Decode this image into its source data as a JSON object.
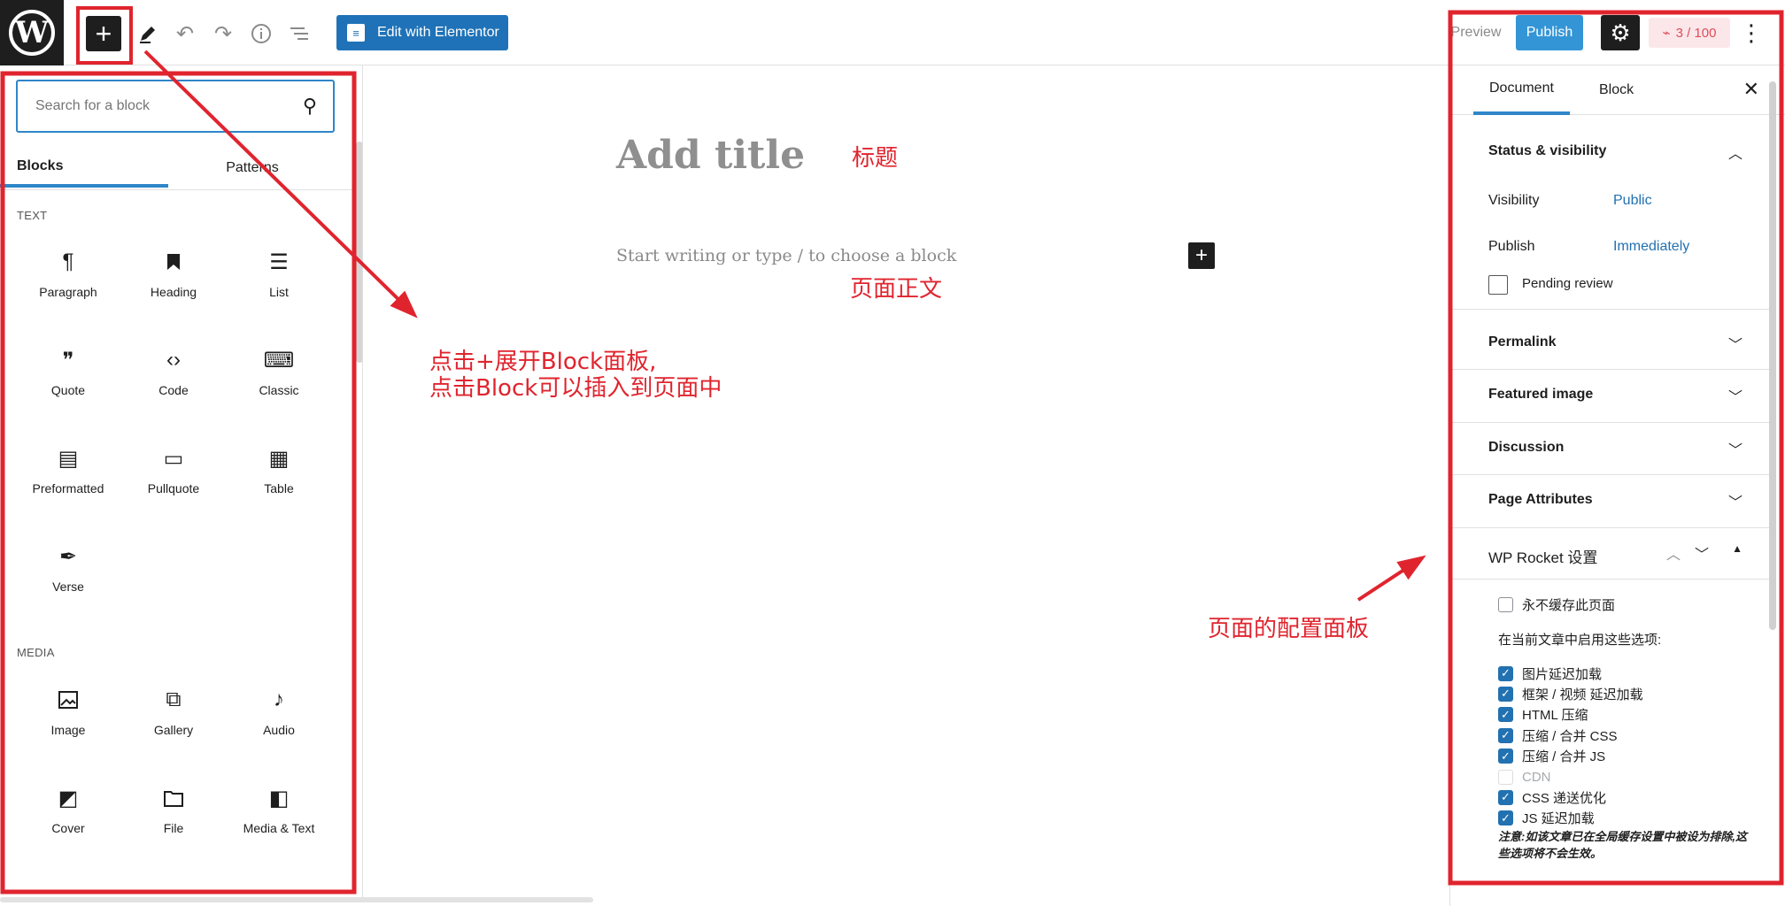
{
  "toolbar": {
    "logo_letter": "W",
    "inserter_glyph": "+",
    "elementor_label": "Edit with Elementor",
    "preview_label": "Preview",
    "publish_label": "Publish",
    "score_label": "3 / 100",
    "accent_color": "#1f72b7",
    "icons": [
      "wordpress-logo",
      "plus-icon",
      "pencil-icon",
      "undo-icon",
      "redo-icon",
      "info-icon",
      "list-view-icon",
      "elementor-icon",
      "gear-icon",
      "seo-score-icon",
      "more-vertical-icon"
    ]
  },
  "inserter": {
    "search_placeholder": "Search for a block",
    "tabs": [
      "Blocks",
      "Patterns"
    ],
    "categories": [
      {
        "label": "TEXT",
        "blocks": [
          {
            "label": "Paragraph",
            "icon": "¶"
          },
          {
            "label": "Heading",
            "icon": "🔖"
          },
          {
            "label": "List",
            "icon": "☰"
          },
          {
            "label": "Quote",
            "icon": "❞"
          },
          {
            "label": "Code",
            "icon": "‹›"
          },
          {
            "label": "Classic",
            "icon": "⌨"
          },
          {
            "label": "Preformatted",
            "icon": "▤"
          },
          {
            "label": "Pullquote",
            "icon": "▭"
          },
          {
            "label": "Table",
            "icon": "▦"
          },
          {
            "label": "Verse",
            "icon": "✒"
          }
        ]
      },
      {
        "label": "MEDIA",
        "blocks": [
          {
            "label": "Image",
            "icon": "🖼"
          },
          {
            "label": "Gallery",
            "icon": "⧉"
          },
          {
            "label": "Audio",
            "icon": "♪"
          },
          {
            "label": "Cover",
            "icon": "◩"
          },
          {
            "label": "File",
            "icon": "🗀"
          },
          {
            "label": "Media & Text",
            "icon": "◧"
          }
        ]
      }
    ]
  },
  "editor": {
    "title_placeholder": "Add title",
    "body_placeholder": "Start writing or type / to choose a block",
    "add_block_glyph": "+"
  },
  "annotations": {
    "title_note": "标题",
    "body_note": "页面正文",
    "inserter_note_line1": "点击+展开Block面板,",
    "inserter_note_line2": "点击Block可以插入到页面中",
    "settings_note": "页面的配置面板",
    "color": "#e0242e"
  },
  "sidebar": {
    "tabs": [
      "Document",
      "Block"
    ],
    "status": {
      "title": "Status & visibility",
      "visibility_label": "Visibility",
      "visibility_value": "Public",
      "publish_label": "Publish",
      "publish_value": "Immediately",
      "pending_label": "Pending review"
    },
    "sections": [
      "Permalink",
      "Featured image",
      "Discussion",
      "Page Attributes"
    ],
    "wp_rocket": {
      "title": "WP Rocket 设置",
      "never_cache_label": "永不缓存此页面",
      "options_intro": "在当前文章中启用这些选项:",
      "options": [
        {
          "label": "图片延迟加载",
          "checked": true,
          "disabled": false
        },
        {
          "label": "框架 / 视频 延迟加载",
          "checked": true,
          "disabled": false
        },
        {
          "label": "HTML 压缩",
          "checked": true,
          "disabled": false
        },
        {
          "label": "压缩 / 合并 CSS",
          "checked": true,
          "disabled": false
        },
        {
          "label": "压缩 / 合并 JS",
          "checked": true,
          "disabled": false
        },
        {
          "label": "CDN",
          "checked": false,
          "disabled": true
        },
        {
          "label": "CSS 递送优化",
          "checked": true,
          "disabled": false
        },
        {
          "label": "JS 延迟加载",
          "checked": true,
          "disabled": false
        }
      ],
      "note": "注意:如该文章已在全局缓存设置中被设为排除,这些选项将不会生效。"
    }
  }
}
